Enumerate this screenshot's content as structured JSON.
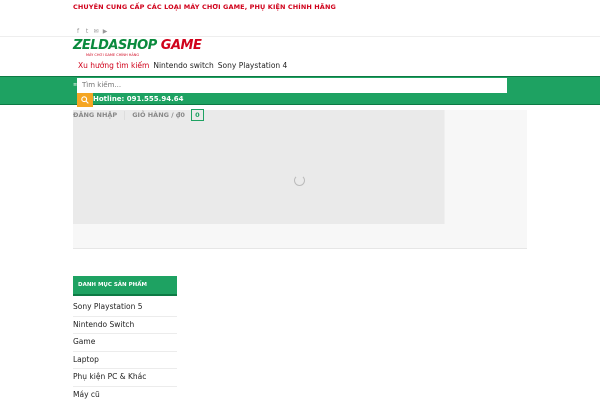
{
  "topbar": {
    "text": "CHUYÊN CUNG CẤP CÁC LOẠI MÁY CHƠI GAME, PHỤ KIỆN CHÍNH HÃNG"
  },
  "socials": [
    {
      "icon": "facebook-icon",
      "glyph": "f"
    },
    {
      "icon": "twitter-icon",
      "glyph": "t"
    },
    {
      "icon": "email-icon",
      "glyph": "✉"
    },
    {
      "icon": "youtube-icon",
      "glyph": "▶"
    }
  ],
  "logo": {
    "part1": "ZELDASHOP",
    "part2": " GAME",
    "tagline": "MÁY CHƠI GAME CHÍNH HÃNG"
  },
  "trending": {
    "label": "Xu hướng tìm kiếm",
    "links": [
      "Nintendo switch",
      "Sony Playstation 4"
    ]
  },
  "search": {
    "placeholder": "Tìm kiếm..."
  },
  "hotline": "Hotline: 091.555.94.64",
  "account": {
    "login": "ĐĂNG NHẬP",
    "cart": "GIỎ HÀNG / ₫0",
    "cart_count": "0"
  },
  "sidebar": {
    "title": "DANH MỤC SẢN PHẨM",
    "items": [
      "Sony Playstation 5",
      "Nintendo Switch",
      "Game",
      "Laptop",
      "Phụ kiện PC & Khác",
      "Máy cũ"
    ]
  },
  "colors": {
    "brand_green": "#1ea262",
    "brand_red": "#d0021b",
    "accent_orange": "#f5a623"
  }
}
